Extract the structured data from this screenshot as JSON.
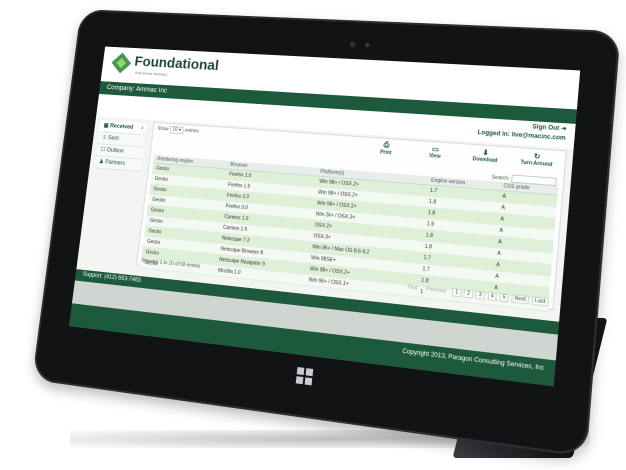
{
  "app": {
    "brand": "Foundational",
    "tagline": "A Business Services"
  },
  "header": {
    "company_label": "Company: Ammac Inc",
    "sign_out": "Sign Out",
    "logged_in": "Logged in: live@macinc.com"
  },
  "sidebar": {
    "items": [
      {
        "label": "Received",
        "icon": "inbox-icon"
      },
      {
        "label": "Sent",
        "icon": "upload-icon"
      },
      {
        "label": "Outbox",
        "icon": "outbox-icon"
      },
      {
        "label": "Partners",
        "icon": "user-icon"
      }
    ]
  },
  "toolbar": {
    "show_label": "Show",
    "show_value": "10",
    "entries_label": "entries",
    "actions": [
      {
        "label": "Print",
        "icon": "printer-icon"
      },
      {
        "label": "View",
        "icon": "view-icon"
      },
      {
        "label": "Download",
        "icon": "download-icon"
      },
      {
        "label": "Turn Around",
        "icon": "turn-around-icon"
      }
    ],
    "search_label": "Search:"
  },
  "table": {
    "columns": [
      "Rendering engine",
      "Browser",
      "Platform(s)",
      "Engine version",
      "CSS grade"
    ],
    "rows": [
      [
        "Gecko",
        "Firefox 1.0",
        "Win 98+ / OSX.2+",
        "1.7",
        "A"
      ],
      [
        "Gecko",
        "Firefox 1.5",
        "Win 98+ / OSX.2+",
        "1.8",
        "A"
      ],
      [
        "Gecko",
        "Firefox 2.0",
        "Win 98+ / OSX.2+",
        "1.8",
        "A"
      ],
      [
        "Gecko",
        "Firefox 3.0",
        "Win 2k+ / OSX.3+",
        "1.9",
        "A"
      ],
      [
        "Gecko",
        "Camino 1.0",
        "OSX.2+",
        "1.8",
        "A"
      ],
      [
        "Gecko",
        "Camino 1.5",
        "OSX.3+",
        "1.8",
        "A"
      ],
      [
        "Gecko",
        "Netscape 7.2",
        "Win 95+ / Mac OS 8.6-9.2",
        "1.7",
        "A"
      ],
      [
        "Gecko",
        "Netscape Browser 8",
        "Win 98SE+",
        "1.7",
        "A"
      ],
      [
        "Gecko",
        "Netscape Navigator 9",
        "Win 98+ / OSX.2+",
        "1.8",
        "A"
      ],
      [
        "Gecko",
        "Mozilla 1.0",
        "Win 95+ / OSX.1+",
        "1",
        "A"
      ]
    ],
    "info": "Showing 1 to 10 of 58 entries"
  },
  "pager": {
    "first": "First",
    "previous": "Previous",
    "pages": [
      "1",
      "2",
      "3",
      "4",
      "5"
    ],
    "next": "Next",
    "last": "Last"
  },
  "footer": {
    "support": "Support: (412) 653-7463",
    "copyright": "Copyright 2013, Paragon Consulting Services, Inc"
  },
  "colors": {
    "primary": "#1d5a3b",
    "accent": "#3f9b4e",
    "row_highlight": "#dff0d8"
  }
}
